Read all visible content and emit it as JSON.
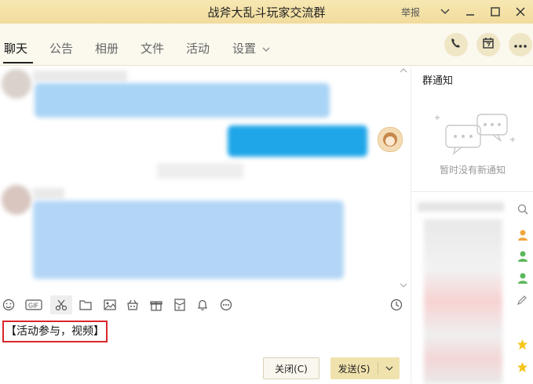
{
  "window": {
    "title": "战斧大乱斗玩家交流群",
    "report_label": "举报"
  },
  "tabs": [
    {
      "label": "聊天"
    },
    {
      "label": "公告"
    },
    {
      "label": "相册"
    },
    {
      "label": "文件"
    },
    {
      "label": "活动"
    },
    {
      "label": "设置"
    }
  ],
  "sidebar": {
    "notice_title": "群通知",
    "notice_empty": "暂时没有新通知"
  },
  "composer": {
    "input_text": "【活动参与，视频】",
    "close_label": "关闭(C)",
    "send_label": "发送(S)"
  },
  "colors": {
    "titlebar": "#f3deA0",
    "accent": "#f0e2ad",
    "bubble_blue": "#a9d4f5",
    "bubble_self": "#1fa6e8",
    "highlight_box": "#d9262a"
  }
}
